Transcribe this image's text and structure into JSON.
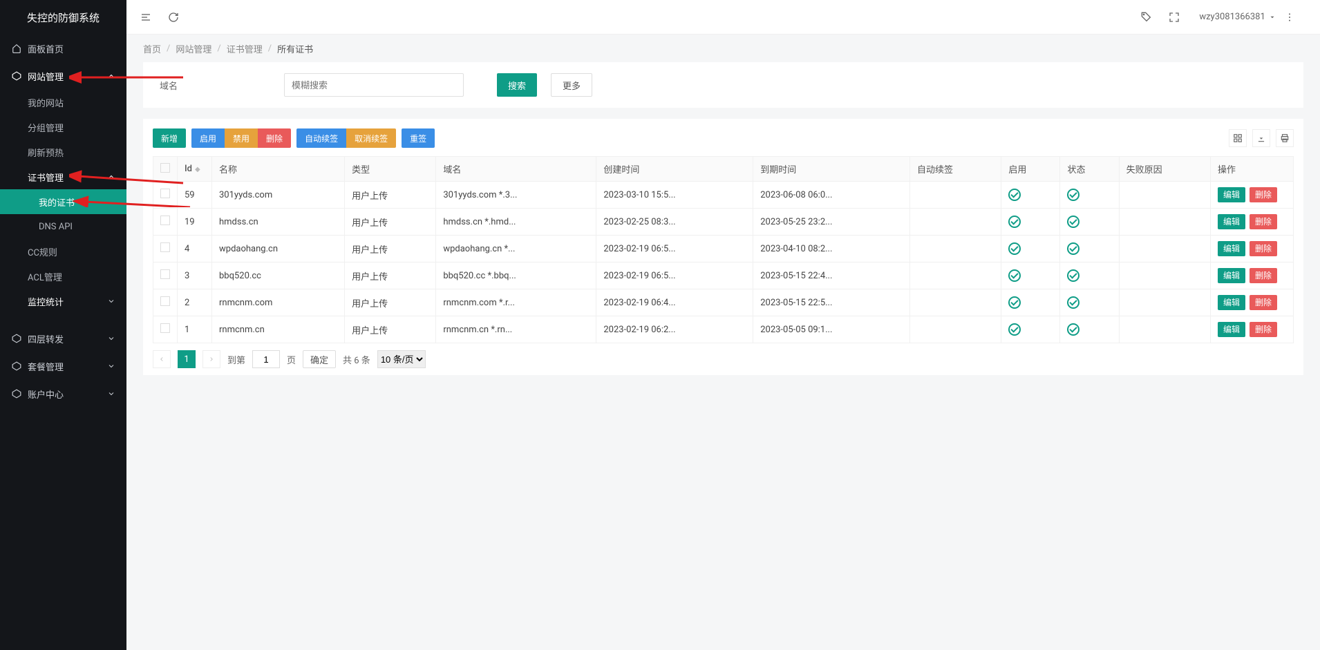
{
  "app_title": "失控的防御系统",
  "header": {
    "user": "wzy3081366381"
  },
  "breadcrumb": [
    "首页",
    "网站管理",
    "证书管理",
    "所有证书"
  ],
  "sidebar": {
    "home": "面板首页",
    "sections": [
      {
        "label": "网站管理",
        "expanded": true,
        "items": [
          {
            "label": "我的网站"
          },
          {
            "label": "分组管理"
          },
          {
            "label": "刷新预热"
          },
          {
            "label": "证书管理",
            "bold": true,
            "expanded": true,
            "subitems": [
              {
                "label": "我的证书",
                "active": true
              },
              {
                "label": "DNS API"
              }
            ]
          },
          {
            "label": "CC规则"
          },
          {
            "label": "ACL管理"
          },
          {
            "label": "监控统计",
            "chevron": true
          }
        ]
      },
      {
        "label": "四层转发"
      },
      {
        "label": "套餐管理"
      },
      {
        "label": "账户中心"
      }
    ]
  },
  "search": {
    "label": "域名",
    "placeholder": "模糊搜索",
    "search_btn": "搜索",
    "more_btn": "更多"
  },
  "toolbar": {
    "add": "新增",
    "enable": "启用",
    "disable": "禁用",
    "delete": "删除",
    "auto_renew": "自动续签",
    "cancel_renew": "取消续签",
    "resign": "重签"
  },
  "table": {
    "columns": [
      "Id",
      "名称",
      "类型",
      "域名",
      "创建时间",
      "到期时间",
      "自动续签",
      "启用",
      "状态",
      "失败原因",
      "操作"
    ],
    "rows": [
      {
        "id": "59",
        "name": "301yyds.com",
        "type": "用户上传",
        "domain": "301yyds.com *.3...",
        "created": "2023-03-10 15:5...",
        "expires": "2023-06-08 06:0...",
        "auto": "",
        "enabled": true,
        "status": true,
        "fail": ""
      },
      {
        "id": "19",
        "name": "hmdss.cn",
        "type": "用户上传",
        "domain": "hmdss.cn *.hmd...",
        "created": "2023-02-25 08:3...",
        "expires": "2023-05-25 23:2...",
        "auto": "",
        "enabled": true,
        "status": true,
        "fail": ""
      },
      {
        "id": "4",
        "name": "wpdaohang.cn",
        "type": "用户上传",
        "domain": "wpdaohang.cn *...",
        "created": "2023-02-19 06:5...",
        "expires": "2023-04-10 08:2...",
        "auto": "",
        "enabled": true,
        "status": true,
        "fail": ""
      },
      {
        "id": "3",
        "name": "bbq520.cc",
        "type": "用户上传",
        "domain": "bbq520.cc *.bbq...",
        "created": "2023-02-19 06:5...",
        "expires": "2023-05-15 22:4...",
        "auto": "",
        "enabled": true,
        "status": true,
        "fail": ""
      },
      {
        "id": "2",
        "name": "rnmcnm.com",
        "type": "用户上传",
        "domain": "rnmcnm.com *.r...",
        "created": "2023-02-19 06:4...",
        "expires": "2023-05-15 22:5...",
        "auto": "",
        "enabled": true,
        "status": true,
        "fail": ""
      },
      {
        "id": "1",
        "name": "rnmcnm.cn",
        "type": "用户上传",
        "domain": "rnmcnm.cn *.rn...",
        "created": "2023-02-19 06:2...",
        "expires": "2023-05-05 09:1...",
        "auto": "",
        "enabled": true,
        "status": true,
        "fail": ""
      }
    ],
    "action_edit": "编辑",
    "action_delete": "删除"
  },
  "pager": {
    "current": "1",
    "goto_label_pre": "到第",
    "goto_label_post": "页",
    "goto_value": "1",
    "confirm": "确定",
    "total": "共 6 条",
    "pagesize": "10 条/页"
  }
}
